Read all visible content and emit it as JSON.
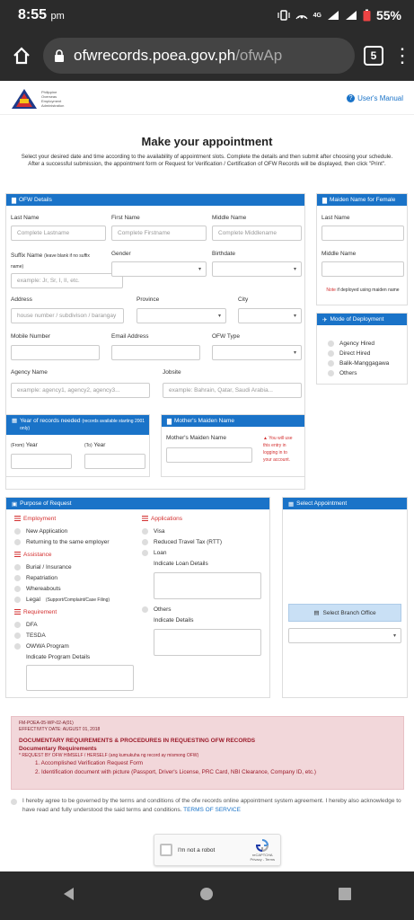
{
  "status": {
    "time": "8:55",
    "ampm": "pm",
    "battery": "55%",
    "network": "4G"
  },
  "browser": {
    "url_domain": "ofwrecords.poea.gov.ph",
    "url_path": "/ofwAp",
    "tab_count": "5"
  },
  "header": {
    "logo_lines": [
      "Philippine",
      "Overseas",
      "Employment",
      "Administration"
    ],
    "manual": "User's Manual"
  },
  "title": "Make your appointment",
  "intro": "Select your desired date and time according to the availability of appointment slots. Complete the details and then submit after choosing your schedule. After a successful submission, the appointment form or Request for Verification / Certification of OFW Records will be displayed, then click \"Print\".",
  "ofw": {
    "header": "OFW Details",
    "last_name": "Last Name",
    "last_ph": "Complete Lastname",
    "first_name": "First Name",
    "first_ph": "Complete Firstname",
    "middle_name": "Middle Name",
    "middle_ph": "Complete Middlename",
    "suffix": "Suffix Name",
    "suffix_note": "(leave blank if no suffix name)",
    "suffix_ph": "example: Jr, Sr, I, II, etc.",
    "gender": "Gender",
    "birthdate": "Birthdate",
    "address": "Address",
    "address_ph": "house number / subdivison / barangay",
    "province": "Province",
    "city": "City",
    "mobile": "Mobile Number",
    "email": "Email Address",
    "ofw_type": "OFW Type",
    "agency": "Agency Name",
    "agency_ph": "example: agency1, agency2, agency3...",
    "jobsite": "Jobsite",
    "jobsite_ph": "example: Bahrain, Qatar, Saudi Arabia..."
  },
  "maiden": {
    "header": "Maiden Name for Female",
    "last": "Last Name",
    "middle": "Middle Name",
    "note_red": "Note",
    "note": "if deployed using maiden name"
  },
  "deployment": {
    "header": "Mode of Deployment",
    "options": [
      "Agency Hired",
      "Direct Hired",
      "Balik-Manggagawa",
      "Others"
    ]
  },
  "year": {
    "header": "Year of records needed",
    "header_note": "(records available starting 2001 only)",
    "from_pre": "(From)",
    "from": "Year",
    "to_pre": "(To)",
    "to": "Year"
  },
  "mother": {
    "header": "Mother's Maiden Name",
    "label": "Mother's Maiden Name",
    "warn": [
      "You will use",
      "this entry in",
      "logging in to",
      "your account."
    ]
  },
  "purpose": {
    "header": "Purpose of Request",
    "employment": "Employment",
    "employment_opts": [
      "New Application",
      "Returning to the same employer"
    ],
    "assistance": "Assistance",
    "assistance_opts": [
      "Burial / Insurance",
      "Repatriation",
      "Whereabouts",
      "Legal"
    ],
    "legal_note": "(Support/Complaint/Case Filing)",
    "requirement": "Requirement",
    "requirement_opts": [
      "DFA",
      "TESDA",
      "OWWA Program"
    ],
    "program_details": "Indicate Program Details",
    "applications": "Applications",
    "applications_opts": [
      "Visa",
      "Reduced Travel Tax (RTT)",
      "Loan"
    ],
    "loan_details": "Indicate Loan Details",
    "others": "Others",
    "others_details": "Indicate Details"
  },
  "appointment": {
    "header": "Select Appointment",
    "branch_btn": "Select Branch Office"
  },
  "requirements": {
    "code": "FM-POEA-05-WP-02-A(01)",
    "effectivity": "EFFECTIVITY DATE: AUGUST 01, 2018",
    "title": "DOCUMENTARY REQUIREMENTS & PROCEDURES IN REQUESTING OFW RECORDS",
    "subtitle": "Documentary Requirements",
    "request_by": "REQUEST BY OFW HIMSELF / HERSELF",
    "request_by_note": "(ang kumukuha ng record ay mismong OFW)",
    "items": [
      "1. Accomplished Verification Request Form",
      "2. Identification document with picture (Passport, Driver's License, PRC Card, NBI Clearance, Company ID, etc.)"
    ]
  },
  "agree": {
    "text": "I hereby agree to be governed by the terms and conditions of the ofw records online appointment system agreement. I hereby also acknowledge to have read and fully understood the said terms and conditions.",
    "link": "TERMS OF SERVICE"
  },
  "captcha": {
    "label": "I'm not a robot",
    "brand": "reCAPTCHA",
    "links": "Privacy - Terms"
  }
}
